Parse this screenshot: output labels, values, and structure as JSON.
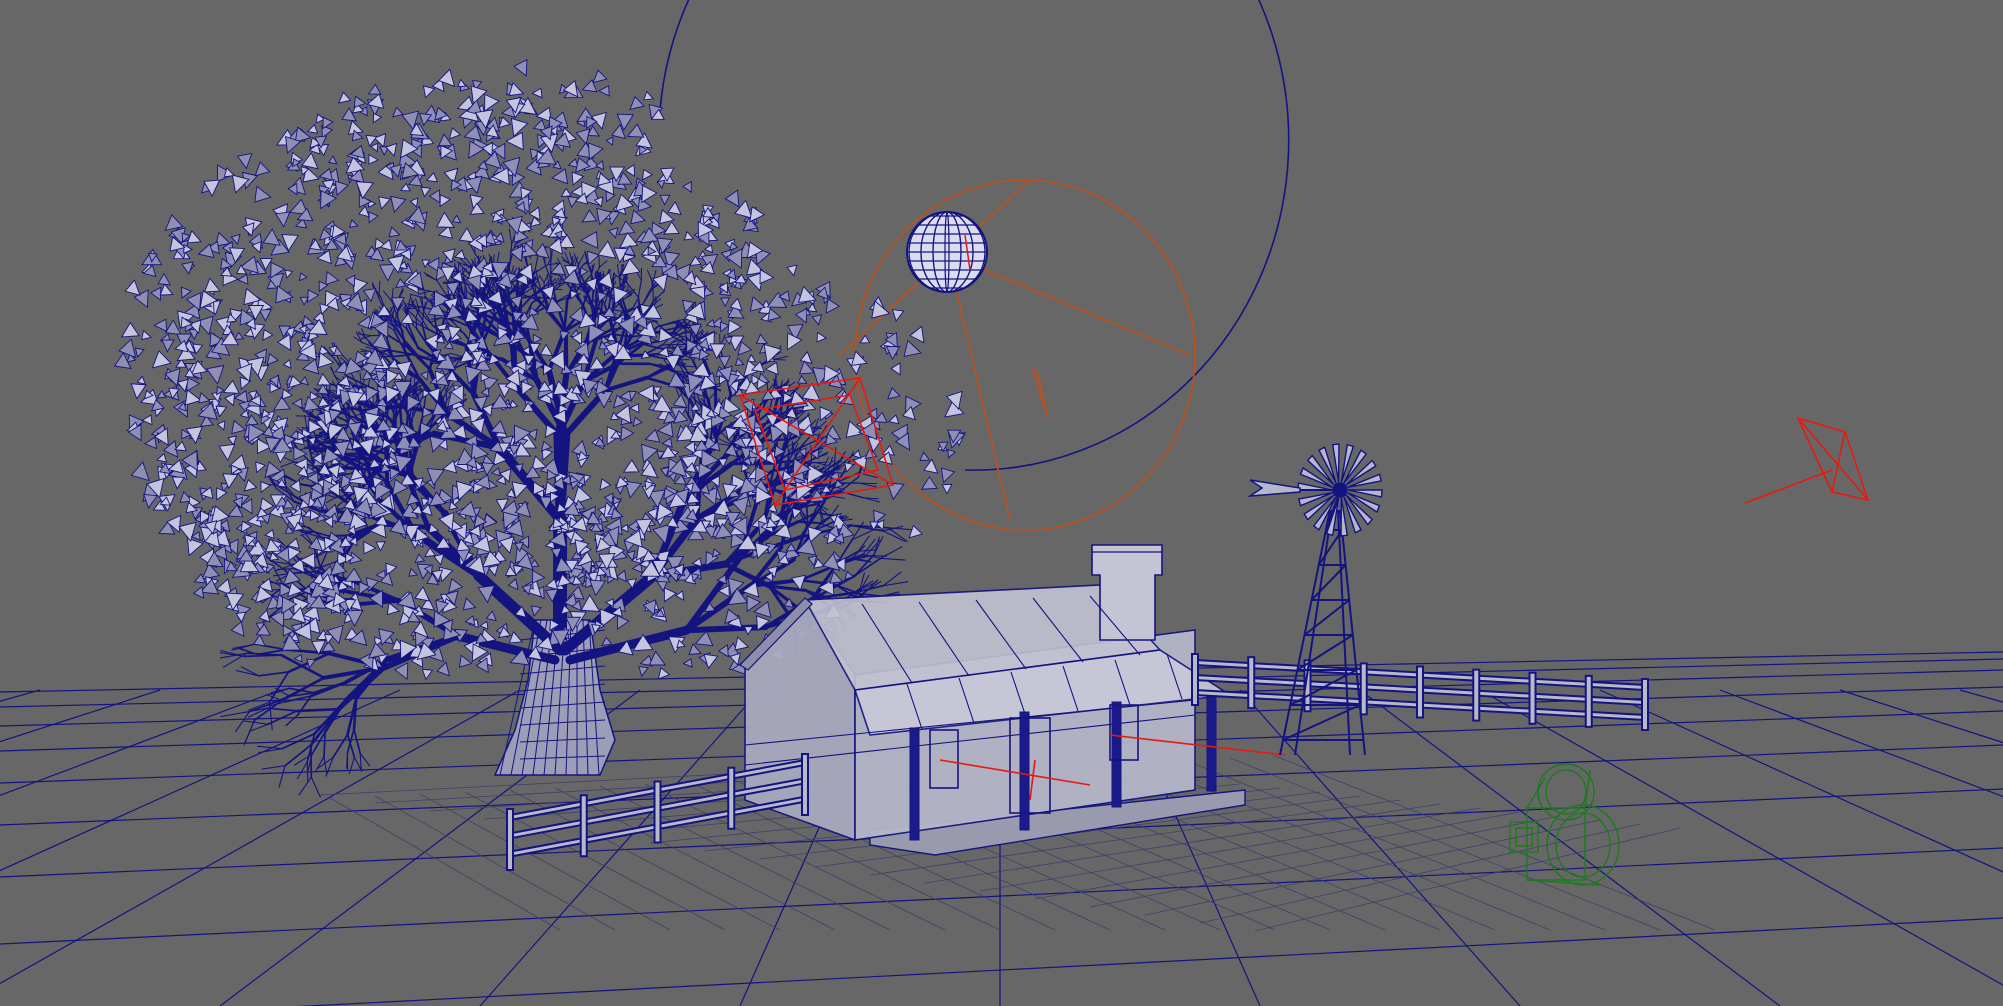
{
  "viewport": {
    "background": "#676767",
    "wire_color": "#141480",
    "selected_color": "#e8190f",
    "light_color": "#c0501a",
    "camera_color": "#1e7a1e",
    "shaded_fill": "#b8b8c8"
  },
  "scene_objects": [
    {
      "name": "ground-grid"
    },
    {
      "name": "oak-tree"
    },
    {
      "name": "farmhouse"
    },
    {
      "name": "windmill"
    },
    {
      "name": "fence-front"
    },
    {
      "name": "fence-back"
    },
    {
      "name": "spot-light"
    },
    {
      "name": "sun-sphere"
    },
    {
      "name": "area-light"
    },
    {
      "name": "directional-light"
    },
    {
      "name": "render-camera"
    }
  ]
}
